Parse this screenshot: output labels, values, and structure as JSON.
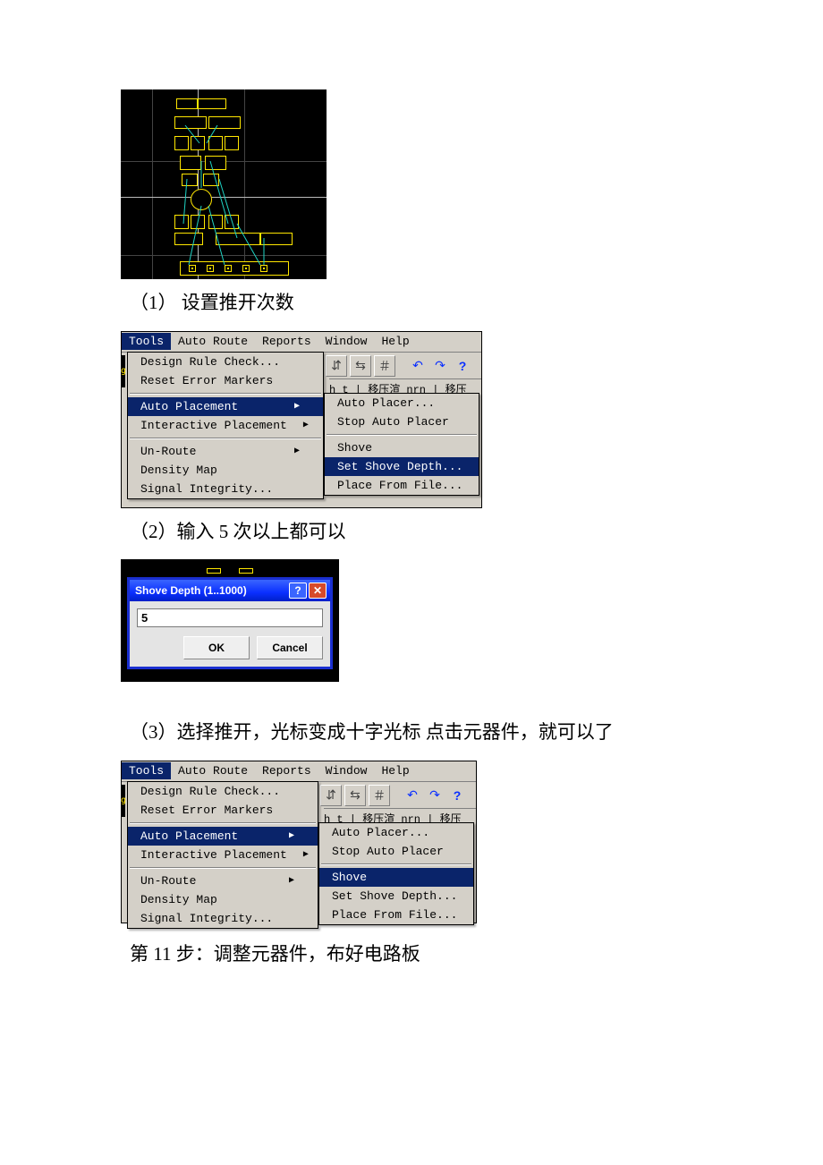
{
  "captions": {
    "c1": "（1） 设置推开次数",
    "c2": "（2）输入 5 次以上都可以",
    "c3": "（3）选择推开，光标变成十字光标  点击元器件，就可以了",
    "step11": "第 11 步：调整元器件，布好电路板"
  },
  "menubar_items": [
    "Tools",
    "Auto Route",
    "Reports",
    "Window",
    "Help"
  ],
  "tools_menu": {
    "items": [
      {
        "label": "Design Rule Check...",
        "submenu": false
      },
      {
        "label": "Reset Error Markers",
        "submenu": false
      },
      {
        "sep": true
      },
      {
        "label": "Auto Placement",
        "submenu": true
      },
      {
        "label": "Interactive Placement",
        "submenu": true
      },
      {
        "sep": true
      },
      {
        "label": "Un-Route",
        "submenu": true
      },
      {
        "label": "Density Map",
        "submenu": false
      },
      {
        "label": "Signal Integrity...",
        "submenu": false
      }
    ]
  },
  "auto_placement_submenu": {
    "items": [
      {
        "label": "Auto Placer..."
      },
      {
        "label": "Stop Auto Placer"
      },
      {
        "sep": true
      },
      {
        "label": "Shove"
      },
      {
        "label": "Set Shove Depth..."
      },
      {
        "label": "Place From File..."
      }
    ]
  },
  "toolbar": {
    "icons": [
      "grid-flip-h",
      "grid-flip-v",
      "grid-icon",
      "undo-icon",
      "redo-icon",
      "help-icon"
    ],
    "glyphs": [
      "⇵",
      "⇆",
      "＃",
      "↶",
      "↷",
      "?"
    ],
    "tabstrip_text": "h_t | 移压渲 nrn | 移压"
  },
  "shove_dialog": {
    "title": "Shove Depth (1..1000)",
    "value": "5",
    "ok": "OK",
    "cancel": "Cancel"
  },
  "figure2_selected_main": "Auto Placement",
  "figure2_selected_sub": "Set Shove Depth...",
  "figure3_selected_main": "Auto Placement",
  "figure3_selected_sub": "Shove"
}
